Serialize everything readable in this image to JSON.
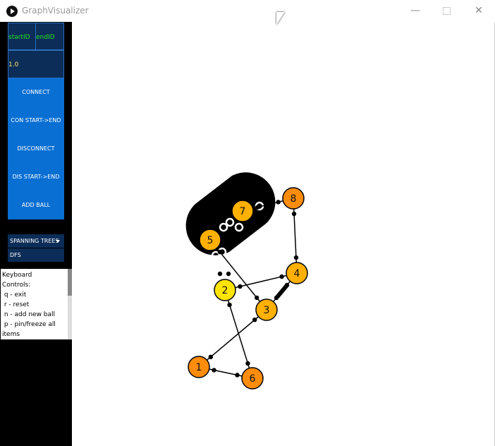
{
  "window": {
    "title": "GraphVisualizer",
    "min_glyph": "—",
    "close_glyph": "✕"
  },
  "controls": {
    "start_id_placeholder": "startID",
    "end_id_placeholder": "endID",
    "weight_value": "1.0",
    "buttons": [
      "CONNECT",
      "CON START->END",
      "DISCONNECT",
      "DIS START->END",
      "ADD BALL"
    ],
    "algorithm_selected": "SPANNING TREES",
    "algorithm_option": "DFS"
  },
  "help": {
    "lines": [
      "Keyboard",
      "Controls:",
      " q - exit",
      " r - reset",
      " n - add new ball",
      " p - pin/freeze all",
      "items"
    ]
  },
  "graph": {
    "nodes": [
      {
        "id": "1",
        "color": "#ff8c0a"
      },
      {
        "id": "2",
        "color": "#ffe400"
      },
      {
        "id": "3",
        "color": "#ffb000"
      },
      {
        "id": "4",
        "color": "#ffb000"
      },
      {
        "id": "5",
        "color": "#ffb000"
      },
      {
        "id": "6",
        "color": "#ff8c0a"
      },
      {
        "id": "7",
        "color": "#ffb000"
      },
      {
        "id": "8",
        "color": "#ff8c0a"
      }
    ],
    "edges": [
      [
        "1",
        "3"
      ],
      [
        "1",
        "6"
      ],
      [
        "2",
        "6"
      ],
      [
        "2",
        "4"
      ],
      [
        "3",
        "4"
      ],
      [
        "7",
        "8"
      ],
      [
        "8",
        "4"
      ],
      [
        "5",
        "3"
      ]
    ],
    "cluster_color": "#000000"
  }
}
